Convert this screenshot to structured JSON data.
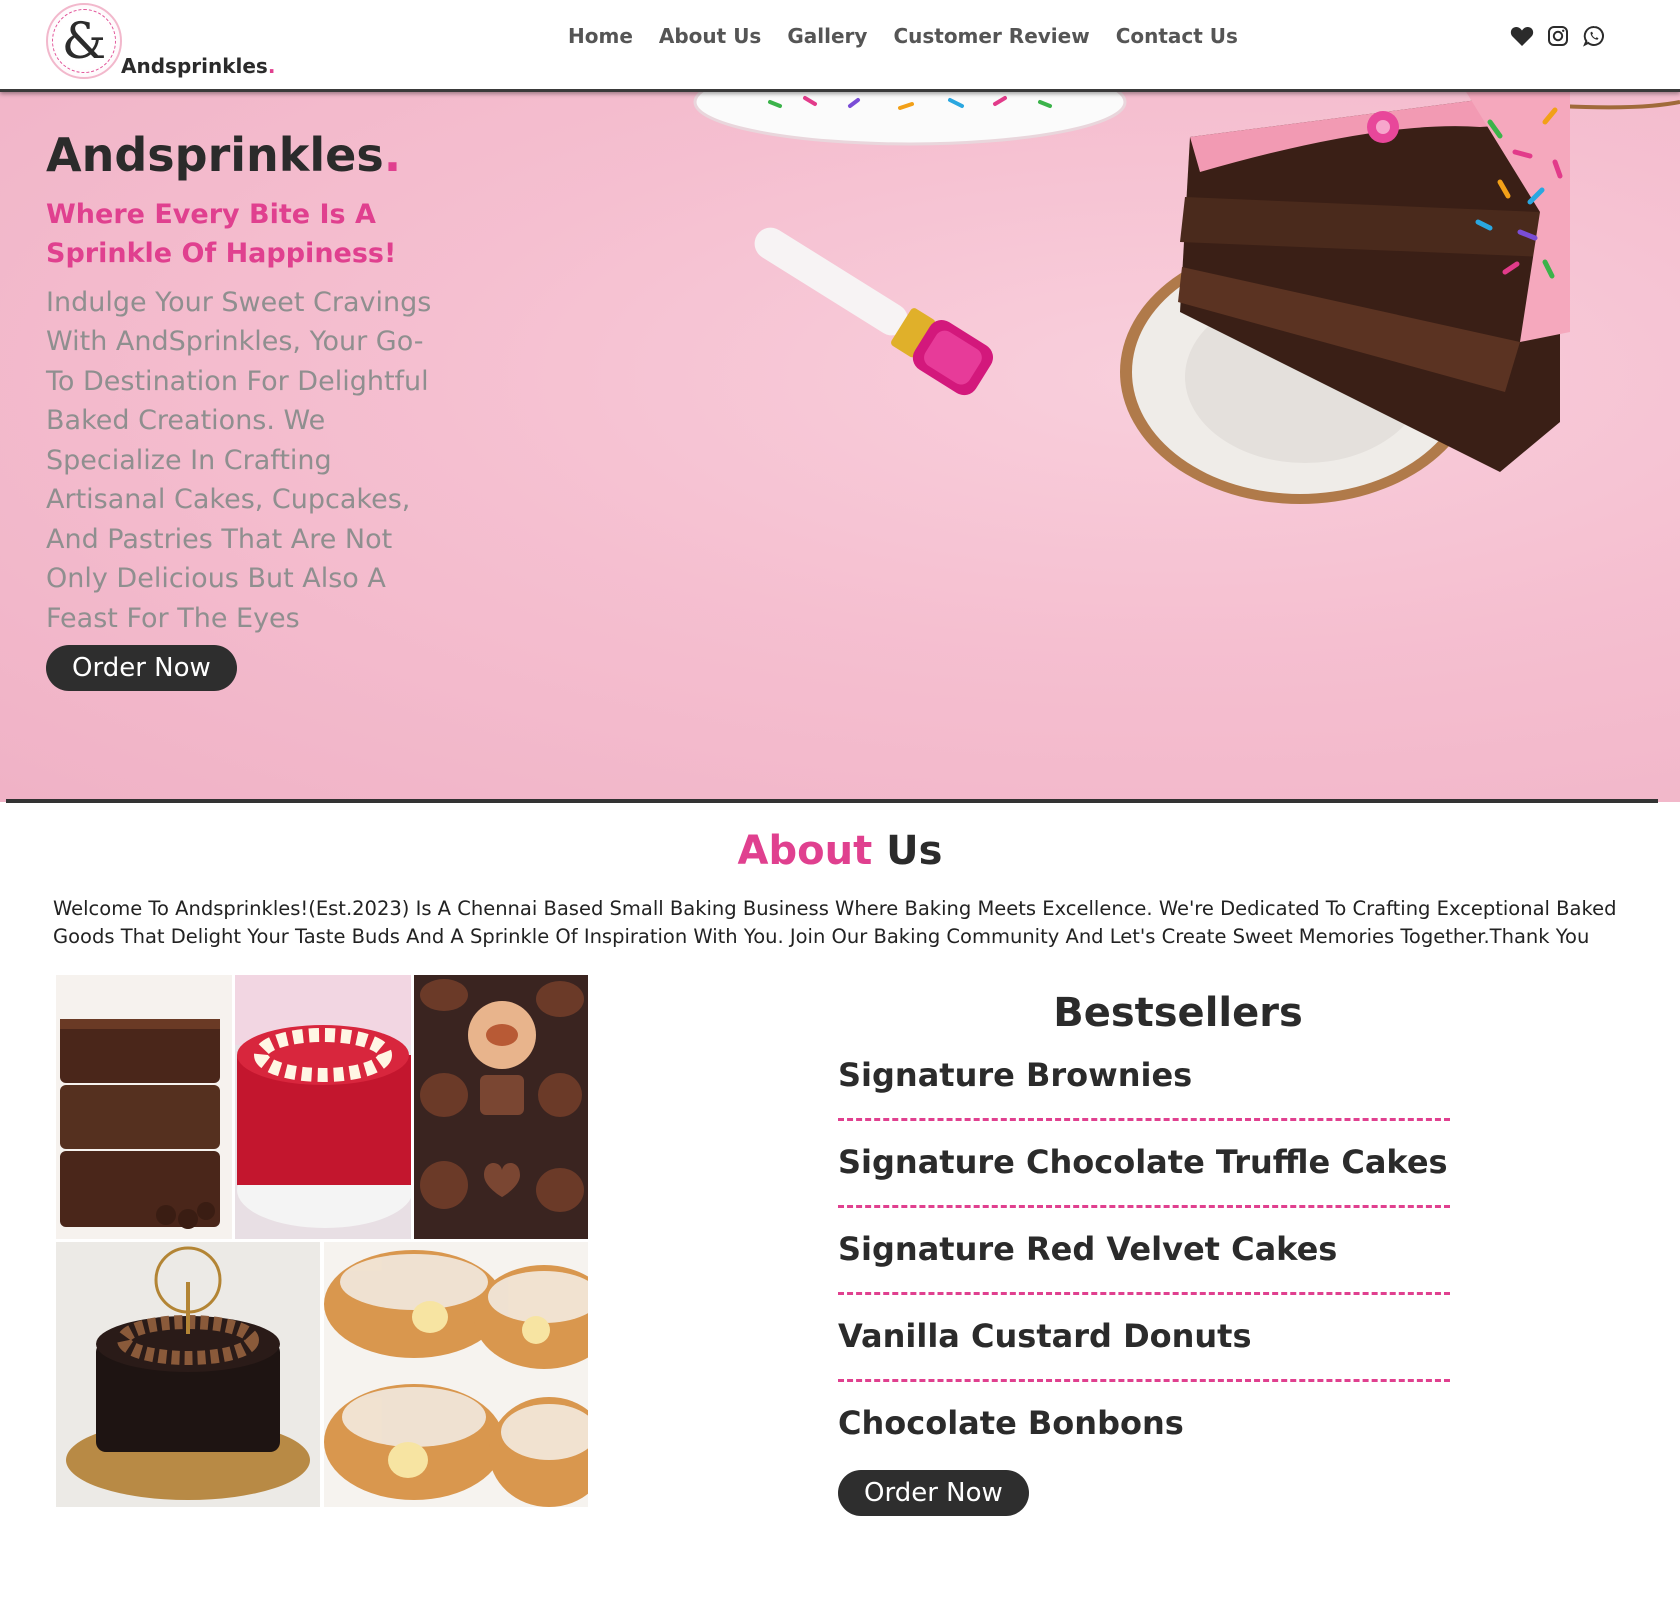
{
  "header": {
    "brand": "Andsprinkles",
    "brand_dot": ".",
    "logo_icon": "ampersand-logo-icon",
    "nav": [
      {
        "label": "Home"
      },
      {
        "label": "About Us"
      },
      {
        "label": "Gallery"
      },
      {
        "label": "Customer Review"
      },
      {
        "label": "Contact Us"
      }
    ],
    "social_icons": [
      "heart-icon",
      "instagram-icon",
      "whatsapp-icon"
    ]
  },
  "hero": {
    "title": "Andsprinkles",
    "title_dot": ".",
    "tagline": "Where Every Bite Is A Sprinkle Of Happiness!",
    "description": "Indulge Your Sweet Cravings With AndSprinkles, Your Go-To Destination For Delightful Baked Creations. We Specialize In Crafting Artisanal Cakes, Cupcakes, And Pastries That Are Not Only Delicious But Also A Feast For The Eyes",
    "button": "Order Now"
  },
  "about": {
    "title_part1": "About",
    "title_part2": "Us",
    "text": "Welcome To Andsprinkles!(Est.2023) Is A Chennai Based Small Baking Business Where Baking Meets Excellence. We're Dedicated To Crafting Exceptional Baked Goods That Delight Your Taste Buds And A Sprinkle Of Inspiration With You. Join Our Baking Community And Let's Create Sweet Memories Together.Thank You"
  },
  "bestsellers": {
    "title": "Bestsellers",
    "items": [
      "Signature Brownies",
      "Signature Chocolate Truffle Cakes",
      "Signature Red Velvet Cakes",
      "Vanilla Custard Donuts",
      "Chocolate Bonbons"
    ],
    "button": "Order Now"
  },
  "colors": {
    "accent": "#e0408f",
    "dark": "#2e2e2e",
    "hero_bg": "#f5bfd0"
  }
}
